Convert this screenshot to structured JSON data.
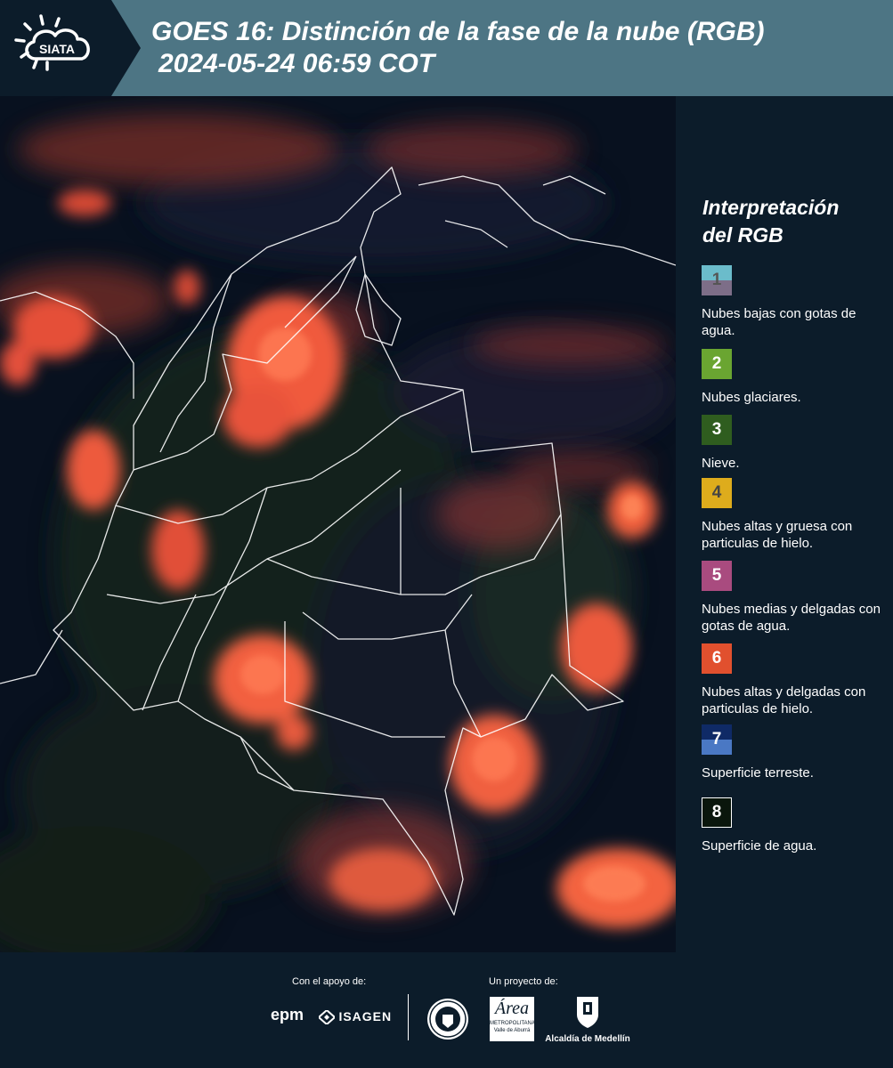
{
  "header": {
    "logo_text": "SIATA",
    "title_line1": "GOES 16: Distinción de la fase de la nube (RGB)",
    "title_line2": "2024-05-24 06:59 COT"
  },
  "legend": {
    "title_line1": "Interpretación",
    "title_line2": "del RGB",
    "items": [
      {
        "number": "1",
        "text": "Nubes bajas con gotas de agua.",
        "color_top": "#6bbccb",
        "color_bottom": "#7d6e88",
        "number_color": "#555555"
      },
      {
        "number": "2",
        "text": "Nubes glaciares.",
        "color_top": "#6aa531",
        "color_bottom": "#6aa531",
        "number_color": "#ffffff"
      },
      {
        "number": "3",
        "text": "Nieve.",
        "color_top": "#2f5d1f",
        "color_bottom": "#2f5d1f",
        "number_color": "#ffffff"
      },
      {
        "number": "4",
        "text": "Nubes altas y gruesa con particulas de hielo.",
        "color_top": "#deac1c",
        "color_bottom": "#deac1c",
        "number_color": "#444444"
      },
      {
        "number": "5",
        "text": "Nubes medias y delgadas con gotas de agua.",
        "color_top": "#a94b7f",
        "color_bottom": "#a94b7f",
        "number_color": "#ffffff"
      },
      {
        "number": "6",
        "text": "Nubes altas y delgadas con particulas de hielo.",
        "color_top": "#e1502e",
        "color_bottom": "#e1502e",
        "number_color": "#ffffff"
      },
      {
        "number": "7",
        "text": "Superficie terreste.",
        "color_top": "#0f2a66",
        "color_bottom": "#4a78c4",
        "number_color": "#ffffff"
      },
      {
        "number": "8",
        "text": "Superficie de agua.",
        "color_top": "#0a160c",
        "color_bottom": "#0a160c",
        "number_color": "#ffffff"
      }
    ]
  },
  "footer": {
    "support_label": "Con el apoyo de:",
    "project_label": "Un proyecto de:",
    "sponsor1": "epm",
    "sponsor2": "ISAGEN",
    "area_text": "Área",
    "area_sub1": "METROPOLITANA",
    "area_sub2": "Valle de Aburrá",
    "alcaldia": "Alcaldía de Medellín"
  }
}
